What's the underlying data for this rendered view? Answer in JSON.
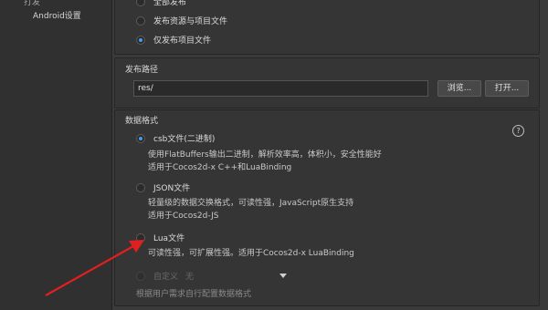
{
  "sidebar": {
    "cut_label": "打发",
    "items": [
      {
        "label": "Android设置"
      }
    ]
  },
  "publish_content": {
    "options": [
      {
        "label": "全部发布",
        "checked": false
      },
      {
        "label": "发布资源与项目文件",
        "checked": false
      },
      {
        "label": "仅发布项目文件",
        "checked": true
      }
    ]
  },
  "publish_path": {
    "title": "发布路径",
    "value": "res/",
    "browse_label": "浏览...",
    "open_label": "打开..."
  },
  "data_format": {
    "title": "数据格式",
    "help_icon": "?",
    "options": [
      {
        "label": "csb文件(二进制)",
        "checked": true,
        "desc": [
          "使用FlatBuffers输出二进制，解析效率高，体积小，安全性能好",
          "适用于Cocos2d-x C++和LuaBinding"
        ]
      },
      {
        "label": "JSON文件",
        "checked": false,
        "desc": [
          "轻量级的数据交换格式，可读性强，JavaScript原生支持",
          "适用于Cocos2d-JS"
        ]
      },
      {
        "label": "Lua文件",
        "checked": false,
        "desc": [
          "可读性强，可扩展性强。适用于Cocos2d-x LuaBinding"
        ]
      },
      {
        "label": "自定义",
        "checked": false,
        "disabled": true,
        "select_value": "无",
        "desc": [
          "根据用户需求自行配置数据格式"
        ]
      }
    ]
  },
  "annotation": {
    "arrow_color": "#e02020"
  }
}
